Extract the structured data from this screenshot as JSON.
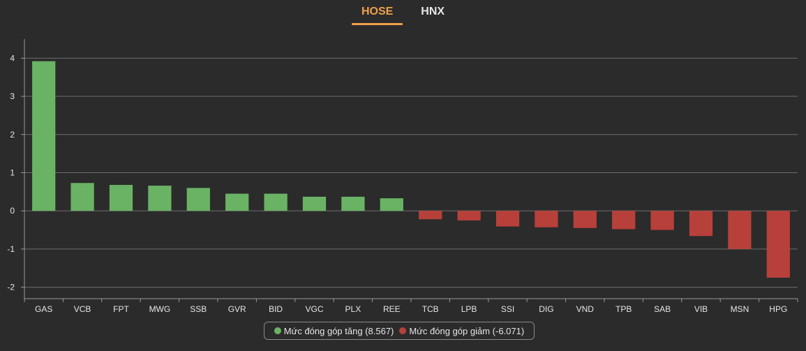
{
  "tabs": [
    {
      "label": "HOSE",
      "active": true
    },
    {
      "label": "HNX",
      "active": false
    }
  ],
  "colors": {
    "background": "#2b2b2b",
    "positive": "#6ab365",
    "negative": "#b8403a",
    "accent": "#f0a04b",
    "grid": "#6e6e6e",
    "text": "#e6e6e6"
  },
  "legend": {
    "positive_label": "Mức đóng góp tăng (8.567)",
    "negative_label": "Mức đóng góp giảm (-6.071)"
  },
  "chart_data": {
    "type": "bar",
    "categories": [
      "GAS",
      "VCB",
      "FPT",
      "MWG",
      "SSB",
      "GVR",
      "BID",
      "VGC",
      "PLX",
      "REE",
      "TCB",
      "LPB",
      "SSI",
      "DIG",
      "VND",
      "TPB",
      "SAB",
      "VIB",
      "MSN",
      "HPG"
    ],
    "values": [
      3.92,
      0.73,
      0.68,
      0.66,
      0.6,
      0.45,
      0.45,
      0.37,
      0.37,
      0.33,
      -0.22,
      -0.25,
      -0.41,
      -0.43,
      -0.45,
      -0.48,
      -0.5,
      -0.66,
      -1.0,
      -1.75
    ],
    "ylim": [
      -2.3,
      4.5
    ],
    "yticks": [
      -2,
      -1,
      0,
      1,
      2,
      3,
      4
    ],
    "grid": true,
    "legend_position": "bottom-center"
  }
}
